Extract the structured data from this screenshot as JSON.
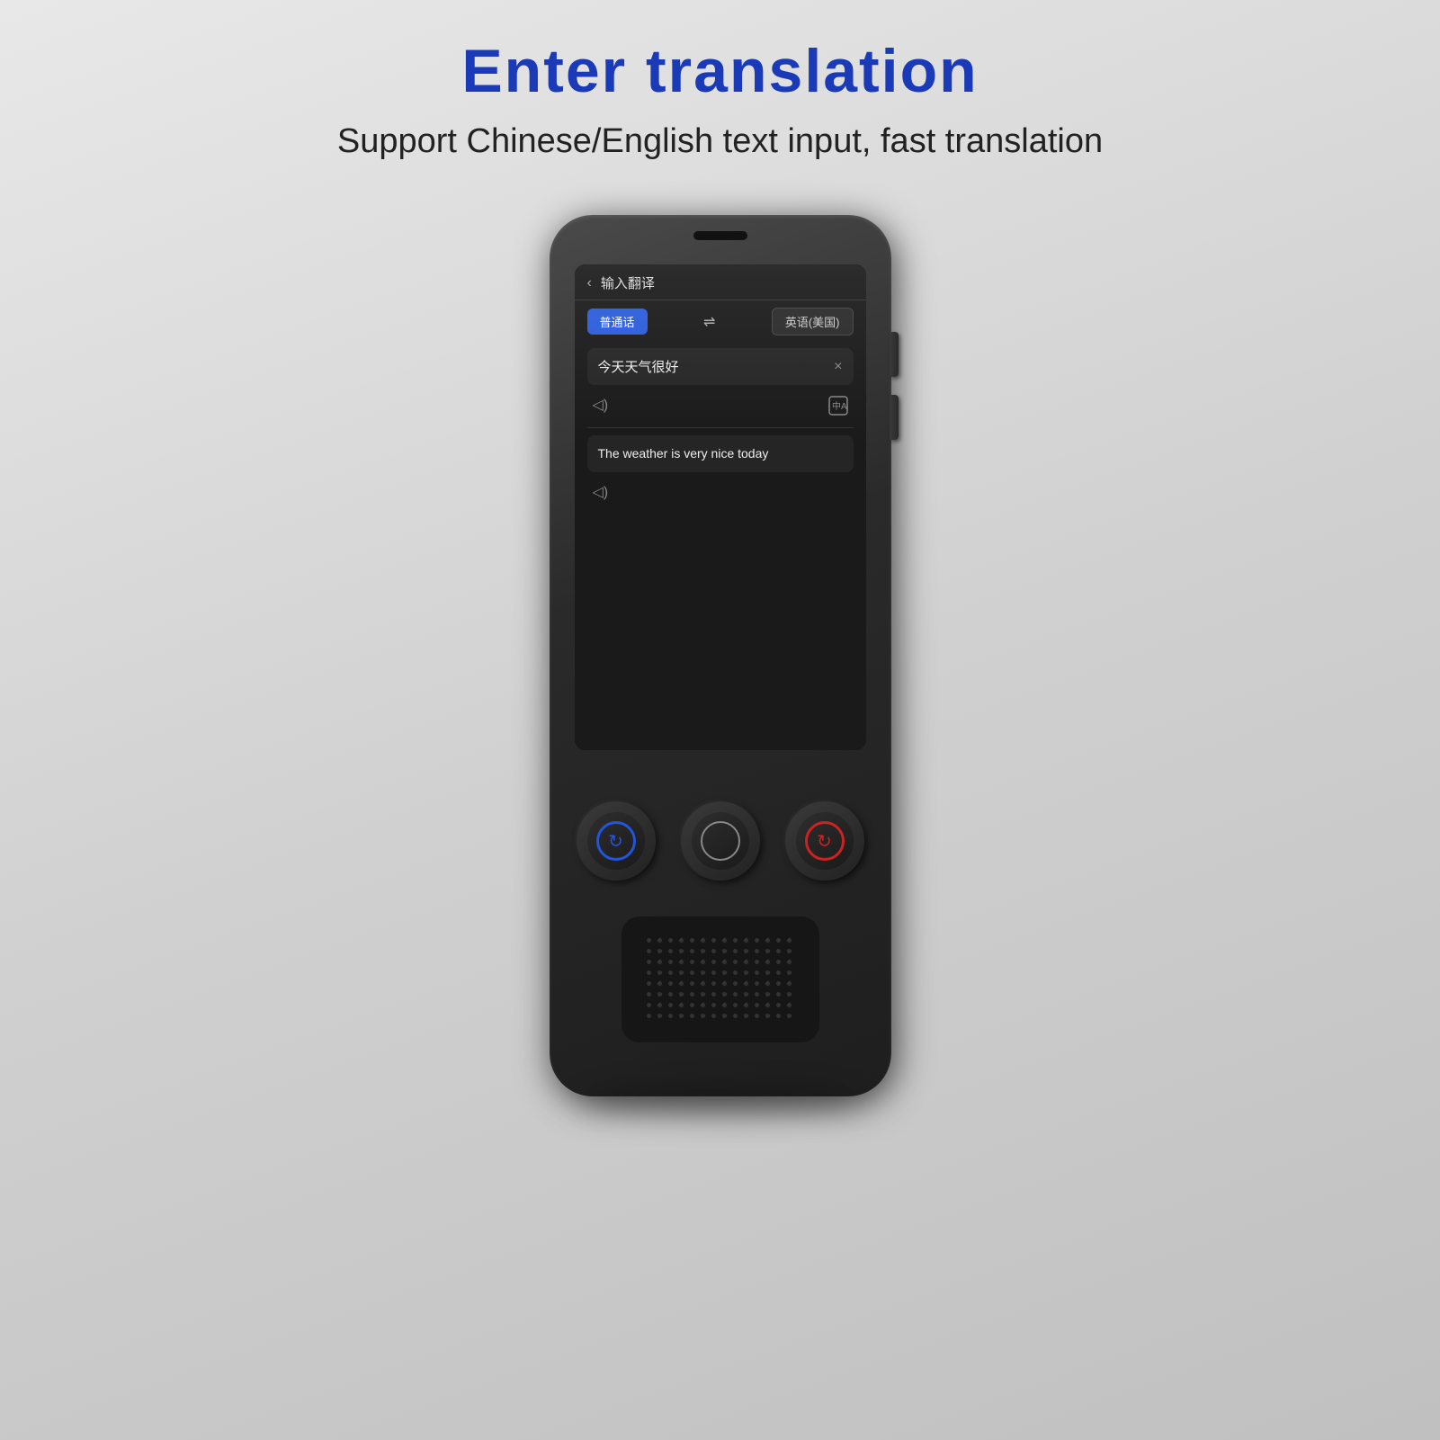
{
  "page": {
    "title": "Enter translation",
    "subtitle": "Support Chinese/English text input, fast translation"
  },
  "device": {
    "screen": {
      "header_title": "输入翻译",
      "back_arrow": "‹",
      "source_lang": "普通话",
      "swap_icon": "⇌",
      "target_lang": "英语(美国)",
      "input_text": "今天天气很好",
      "close_icon": "×",
      "speaker_icon": "🔊",
      "translate_icon": "⊞",
      "translated_text": "The weather is very nice today"
    },
    "buttons": {
      "left_label": "blue-refresh",
      "center_label": "white-circle",
      "right_label": "red-refresh"
    }
  }
}
